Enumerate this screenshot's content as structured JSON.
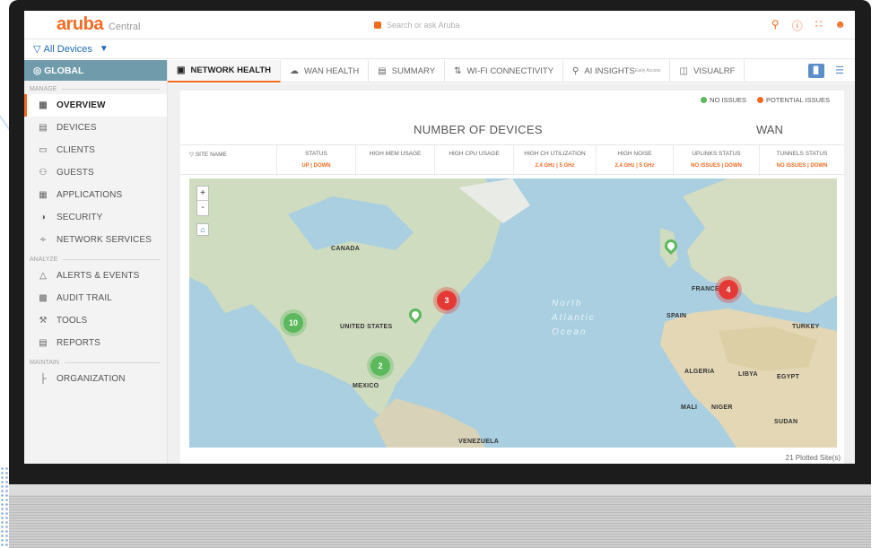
{
  "brand": {
    "logo": "aruba",
    "product": "Central",
    "accent": "#f26b21"
  },
  "search": {
    "placeholder": "Search or ask Aruba"
  },
  "filter": {
    "label": "All Devices"
  },
  "sidebar": {
    "global": "GLOBAL",
    "sections": {
      "manage": "MANAGE",
      "analyze": "ANALYZE",
      "maintain": "MAINTAIN"
    },
    "manage_items": [
      {
        "label": "OVERVIEW",
        "icon": "overview-icon"
      },
      {
        "label": "DEVICES",
        "icon": "devices-icon"
      },
      {
        "label": "CLIENTS",
        "icon": "clients-icon"
      },
      {
        "label": "GUESTS",
        "icon": "guests-icon"
      },
      {
        "label": "APPLICATIONS",
        "icon": "applications-icon"
      },
      {
        "label": "SECURITY",
        "icon": "security-icon"
      },
      {
        "label": "NETWORK SERVICES",
        "icon": "network-services-icon"
      }
    ],
    "analyze_items": [
      {
        "label": "ALERTS & EVENTS",
        "icon": "bell-icon"
      },
      {
        "label": "AUDIT TRAIL",
        "icon": "audit-icon"
      },
      {
        "label": "TOOLS",
        "icon": "tools-icon"
      },
      {
        "label": "REPORTS",
        "icon": "reports-icon"
      }
    ],
    "maintain_items": [
      {
        "label": "ORGANIZATION",
        "icon": "organization-icon"
      }
    ]
  },
  "tabs": [
    {
      "label": "NETWORK HEALTH"
    },
    {
      "label": "WAN HEALTH"
    },
    {
      "label": "SUMMARY"
    },
    {
      "label": "WI-FI CONNECTIVITY"
    },
    {
      "label": "AI INSIGHTS",
      "badge": "Early Access"
    },
    {
      "label": "VISUALRF"
    }
  ],
  "legend": {
    "no_issues": "NO ISSUES",
    "potential_issues": "POTENTIAL ISSUES",
    "green": "#5cb85c",
    "red": "#e53935"
  },
  "headers": {
    "devices": "NUMBER OF DEVICES",
    "wan": "WAN"
  },
  "columns": [
    {
      "title": "SITE NAME",
      "sub": ""
    },
    {
      "title": "STATUS",
      "sub": "UP | DOWN"
    },
    {
      "title": "HIGH MEM USAGE",
      "sub": ""
    },
    {
      "title": "HIGH CPU USAGE",
      "sub": ""
    },
    {
      "title": "HIGH CH UTILIZATION",
      "sub": "2.4 GHz | 5 GHz"
    },
    {
      "title": "HIGH NOISE",
      "sub": "2.4 GHz | 5 GHz"
    },
    {
      "title": "UPLINKS STATUS",
      "sub": "NO ISSUES | DOWN"
    },
    {
      "title": "TUNNELS STATUS",
      "sub": "NO ISSUES | DOWN"
    }
  ],
  "map": {
    "zoom_in": "+",
    "zoom_out": "-",
    "labels": [
      "CANADA",
      "UNITED STATES",
      "MEXICO",
      "VENEZUELA",
      "SPAIN",
      "FRANCE",
      "ALGERIA",
      "LIBYA",
      "EGYPT",
      "MALI",
      "NIGER",
      "SUDAN",
      "TURKEY"
    ],
    "ocean": [
      "North",
      "Atlantic",
      "Ocean"
    ],
    "clusters": [
      {
        "count": "10",
        "status": "green"
      },
      {
        "count": "2",
        "status": "green"
      },
      {
        "count": "3",
        "status": "red"
      },
      {
        "count": "4",
        "status": "red"
      }
    ],
    "plotted": "21 Plotted Site(s)"
  }
}
